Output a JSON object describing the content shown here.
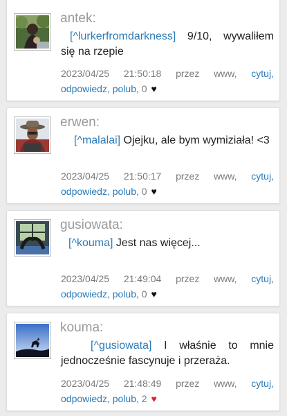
{
  "posts": [
    {
      "username": "antek:",
      "mention": "[^lurkerfromdarkness]",
      "text": " 9/10, wywaliłem się na rzepie",
      "date": "2023/04/25",
      "time": "21:50:18",
      "via": "przez",
      "source": "www,",
      "quote_label": "cytuj,",
      "reply_label": "odpowiedz,",
      "like_label": "polub,",
      "likes": "0",
      "heart_color": "#111111",
      "avatar_icon": "avatar-photo"
    },
    {
      "username": "erwen:",
      "mention": "[^malalai]",
      "text": " Ojejku, ale bym wymiziała! <3",
      "date": "2023/04/25",
      "time": "21:50:17",
      "via": "przez",
      "source": "www,",
      "quote_label": "cytuj,",
      "reply_label": "odpowiedz,",
      "like_label": "polub,",
      "likes": "0",
      "heart_color": "#111111",
      "avatar_icon": "avatar-photo"
    },
    {
      "username": "gusiowata:",
      "mention": "[^kouma]",
      "text": " Jest nas więcej...",
      "date": "2023/04/25",
      "time": "21:49:04",
      "via": "przez",
      "source": "www,",
      "quote_label": "cytuj,",
      "reply_label": "odpowiedz,",
      "like_label": "polub,",
      "likes": "0",
      "heart_color": "#111111",
      "avatar_icon": "avatar-photo"
    },
    {
      "username": "kouma:",
      "mention": "[^gusiowata]",
      "text": " I właśnie to mnie jednocześnie fascynuje i przeraża.",
      "date": "2023/04/25",
      "time": "21:48:49",
      "via": "przez",
      "source": "www,",
      "quote_label": "cytuj,",
      "reply_label": "odpowiedz,",
      "like_label": "polub,",
      "likes": "2",
      "heart_color": "#e0202b",
      "avatar_icon": "avatar-photo"
    }
  ],
  "colors": {
    "link": "#2b7bb9",
    "username": "#9a9a9a",
    "meta": "#7a7a7a",
    "heart_liked": "#e0202b",
    "heart_default": "#111111"
  }
}
